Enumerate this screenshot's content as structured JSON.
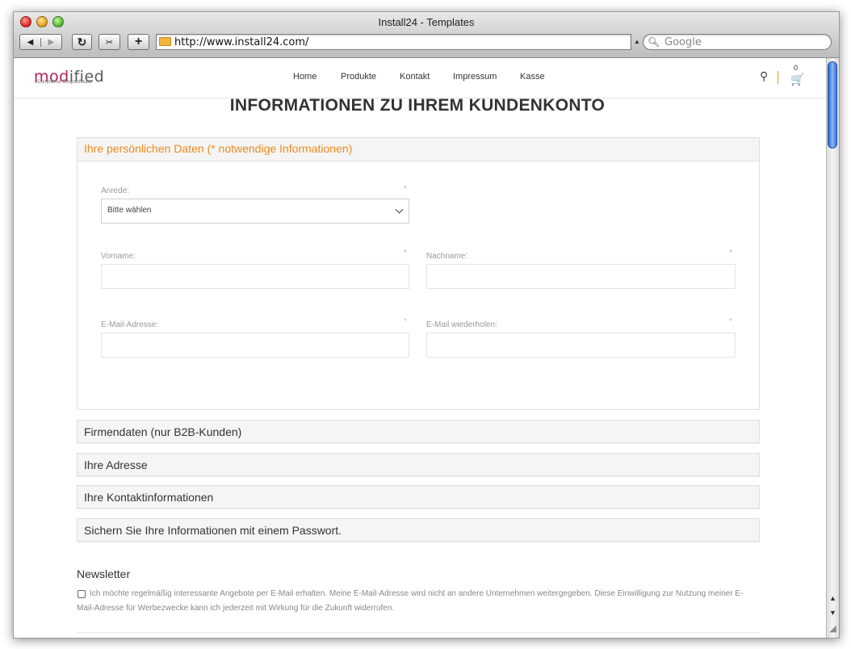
{
  "window": {
    "title": "Install24 - Templates",
    "url": "http://www.install24.com/",
    "search_placeholder": "Google"
  },
  "toolbar": {
    "back_icon": "◀",
    "forward_icon": "▶",
    "reload_icon": "↻",
    "snap_icon": "✂",
    "add_icon": "+"
  },
  "site": {
    "logo_mod": "mod",
    "logo_fied": "ified",
    "logo_tagline": "eCommerce Shopsoftware",
    "nav": [
      {
        "label": "Home"
      },
      {
        "label": "Produkte"
      },
      {
        "label": "Kontakt"
      },
      {
        "label": "Impressum"
      },
      {
        "label": "Kasse"
      }
    ],
    "cart_count": "0",
    "search_icon": "⚲",
    "cart_icon": "🛒"
  },
  "page": {
    "title": "INFORMATIONEN ZU IHREM KUNDENKONTO",
    "personal": {
      "title": "Ihre persönlichen Daten (* notwendige Informationen)",
      "required_mark": "*",
      "anrede_label": "Anrede:",
      "anrede_value": "Bitte wählen",
      "vorname_label": "Vorname:",
      "nachname_label": "Nachname:",
      "email_label": "E-Mail-Adresse:",
      "email_repeat_label": "E-Mail wiederholen:"
    },
    "sections": [
      {
        "label": "Firmendaten (nur B2B-Kunden)"
      },
      {
        "label": "Ihre Adresse"
      },
      {
        "label": "Ihre Kontaktinformationen"
      },
      {
        "label": "Sichern Sie Ihre Informationen mit einem Passwort."
      }
    ],
    "newsletter": {
      "title": "Newsletter",
      "text": "Ich möchte regelmäßig interessante Angebote per E-Mail erhalten. Meine E-Mail-Adresse wird nicht an andere Unternehmen weitergegeben. Diese Einwilligung zur Nutzung meiner E-Mail-Adresse für Werbezwecke kann ich jederzeit mit Wirkung für die Zukunft widerrufen."
    }
  }
}
